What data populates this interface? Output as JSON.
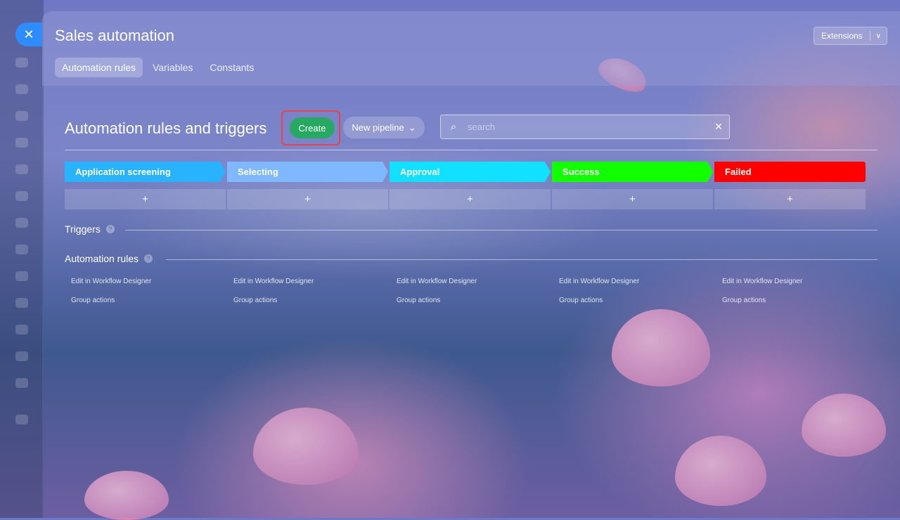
{
  "window": {
    "title": "Sales automation",
    "extensions_label": "Extensions",
    "tabs": [
      {
        "label": "Automation rules",
        "active": true
      },
      {
        "label": "Variables",
        "active": false
      },
      {
        "label": "Constants",
        "active": false
      }
    ]
  },
  "toolbar": {
    "heading": "Automation rules and triggers",
    "create_label": "Create",
    "pipeline_label": "New pipeline",
    "search_placeholder": "search"
  },
  "stages": [
    {
      "label": "Application screening",
      "color": "#29b3ff"
    },
    {
      "label": "Selecting",
      "color": "#80b8ff"
    },
    {
      "label": "Approval",
      "color": "#12e0ff"
    },
    {
      "label": "Success",
      "color": "#12ff00"
    },
    {
      "label": "Failed",
      "color": "#ff0000"
    }
  ],
  "add_label": "+",
  "triggers": {
    "label": "Triggers",
    "help": "?"
  },
  "rules": {
    "label": "Automation rules",
    "help": "?"
  },
  "columns": [
    {
      "edit": "Edit in Workflow Designer",
      "group": "Group actions"
    },
    {
      "edit": "Edit in Workflow Designer",
      "group": "Group actions"
    },
    {
      "edit": "Edit in Workflow Designer",
      "group": "Group actions"
    },
    {
      "edit": "Edit in Workflow Designer",
      "group": "Group actions"
    },
    {
      "edit": "Edit in Workflow Designer",
      "group": "Group actions"
    }
  ],
  "icons": {
    "close": "close-icon",
    "search": "search-icon",
    "clear": "clear-icon",
    "chevron": "chevron-down-icon"
  }
}
